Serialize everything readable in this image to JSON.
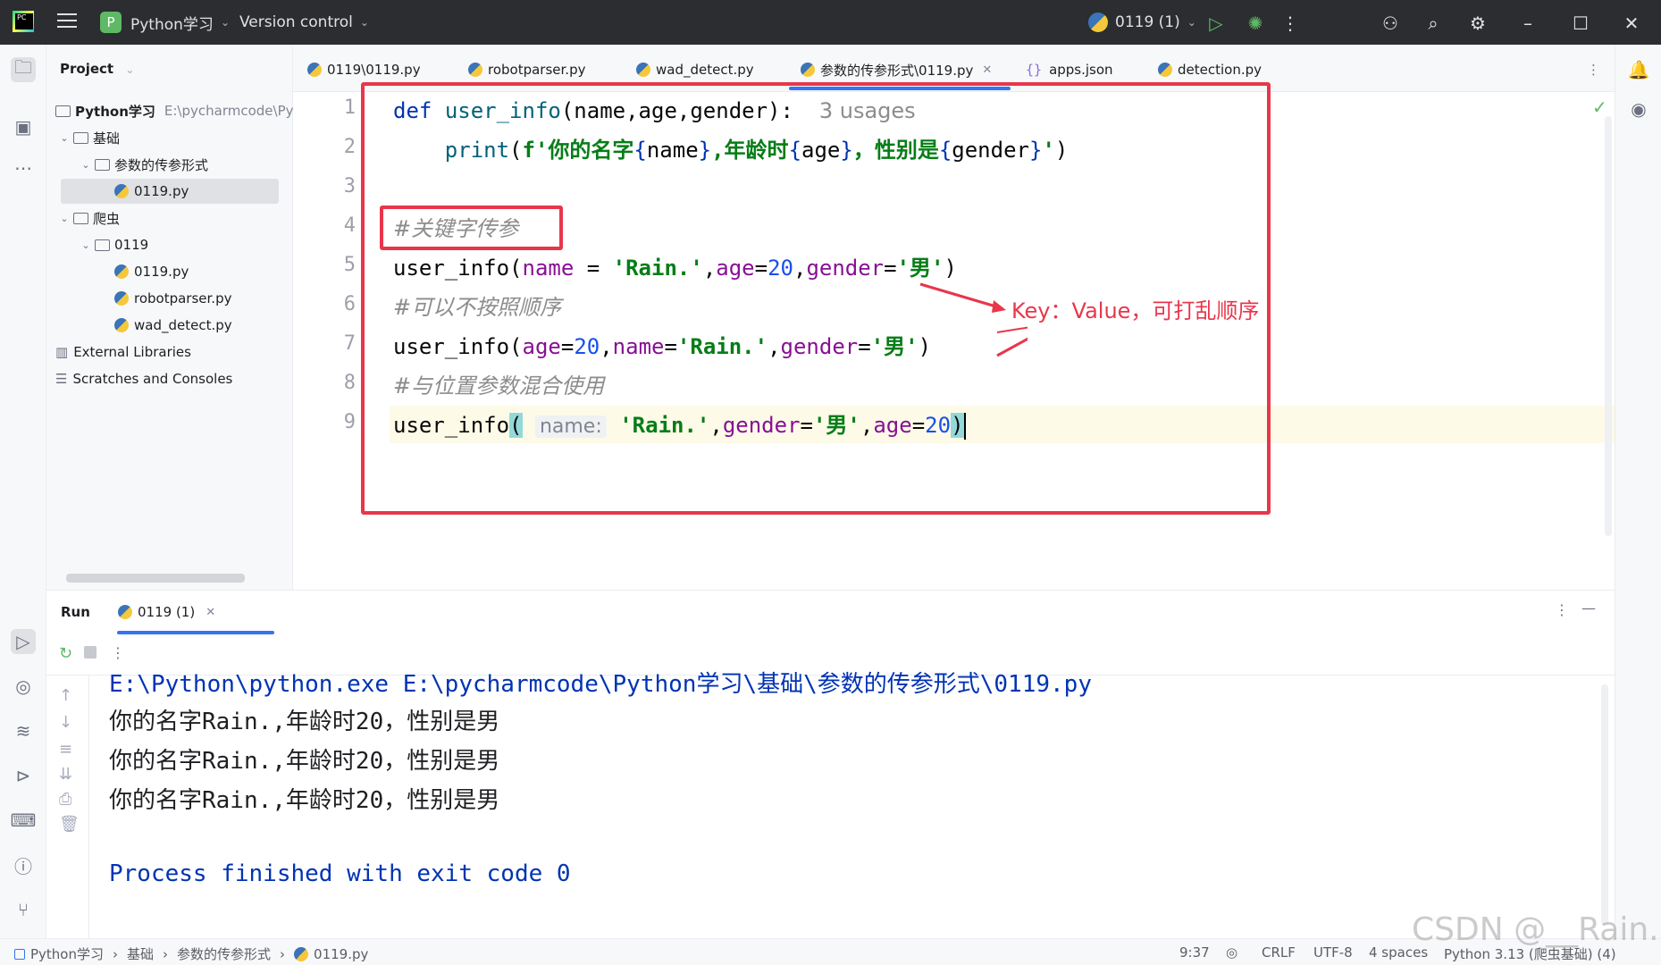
{
  "titlebar": {
    "project_badge": "P",
    "project_name": "Python学习",
    "vcs": "Version control",
    "run_config": "0119 (1)"
  },
  "project_panel": {
    "title": "Project",
    "root_name": "Python学习",
    "root_path": "E:\\pycharmcode\\Pytl",
    "items": [
      {
        "label": "基础"
      },
      {
        "label": "参数的传参形式"
      },
      {
        "label": "0119.py"
      },
      {
        "label": "爬虫"
      },
      {
        "label": "0119"
      },
      {
        "label": "0119.py"
      },
      {
        "label": "robotparser.py"
      },
      {
        "label": "wad_detect.py"
      },
      {
        "label": "External Libraries"
      },
      {
        "label": "Scratches and Consoles"
      }
    ]
  },
  "tabs": [
    {
      "label": "0119\\0119.py"
    },
    {
      "label": "robotparser.py"
    },
    {
      "label": "wad_detect.py"
    },
    {
      "label": "参数的传参形式\\0119.py"
    },
    {
      "label": "apps.json"
    },
    {
      "label": "detection.py"
    }
  ],
  "editor": {
    "line_numbers": [
      "1",
      "2",
      "3",
      "4",
      "5",
      "6",
      "7",
      "8",
      "9"
    ],
    "usages_hint": "3 usages",
    "inlay_name": "name:",
    "comment1": "#关键字传参",
    "comment2": "#可以不按照顺序",
    "comment3": "#与位置参数混合使用"
  },
  "annotation": "Key：Value，可打乱顺序",
  "run_panel": {
    "title": "Run",
    "tab": "0119 (1)",
    "output": [
      "E:\\Python\\python.exe E:\\pycharmcode\\Python学习\\基础\\参数的传参形式\\0119.py",
      "你的名字Rain.,年龄时20，性别是男",
      "你的名字Rain.,年龄时20，性别是男",
      "你的名字Rain.,年龄时20，性别是男",
      "Process finished with exit code 0"
    ]
  },
  "statusbar": {
    "breadcrumb": [
      "Python学习",
      "基础",
      "参数的传参形式",
      "0119.py"
    ],
    "position": "9:37",
    "line_sep": "CRLF",
    "encoding": "UTF-8",
    "indent": "4 spaces",
    "interpreter": "Python 3.13 (爬虫基础) (4)"
  },
  "watermark": "CSDN @__Rain."
}
